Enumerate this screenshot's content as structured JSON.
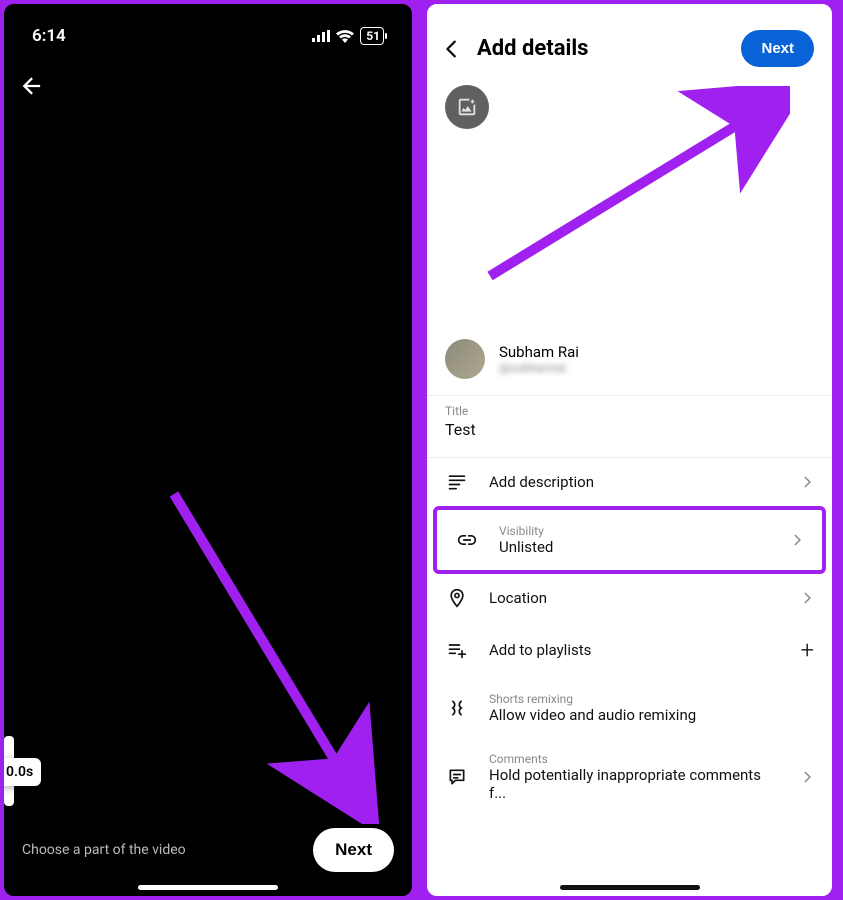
{
  "left": {
    "status_time": "6:14",
    "battery": "51",
    "trim_time": "0.0s",
    "hint": "Choose a part of the video",
    "next": "Next"
  },
  "right": {
    "header_title": "Add details",
    "next": "Next",
    "user_name": "Subham Rai",
    "user_handle": "@subhamrai",
    "title_label": "Title",
    "title_value": "Test",
    "description_label": "Add description",
    "visibility_label": "Visibility",
    "visibility_value": "Unlisted",
    "location_label": "Location",
    "playlists_label": "Add to playlists",
    "remix_label": "Shorts remixing",
    "remix_value": "Allow video and audio remixing",
    "comments_label": "Comments",
    "comments_value": "Hold potentially inappropriate comments f..."
  }
}
